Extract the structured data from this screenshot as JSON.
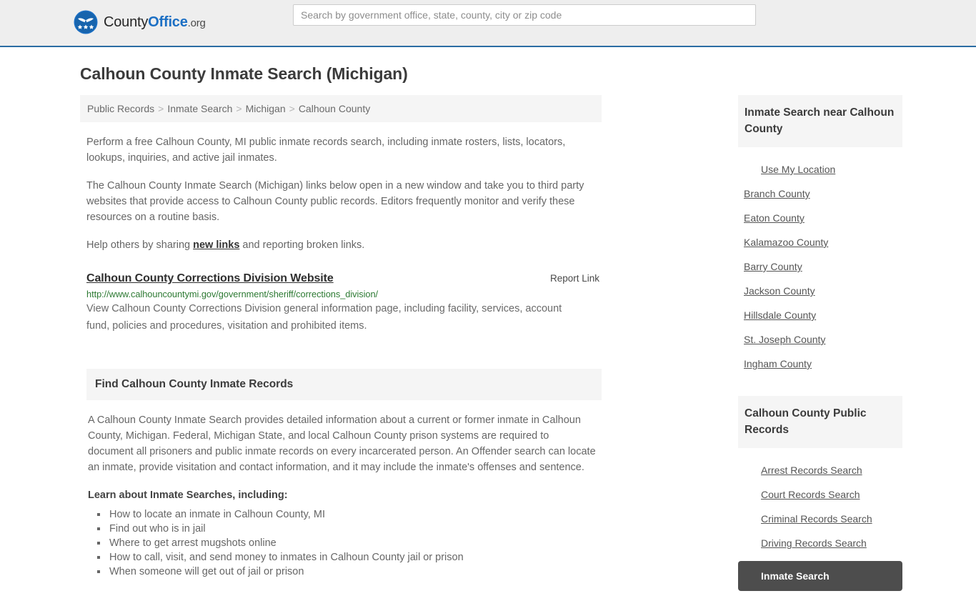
{
  "header": {
    "brand": {
      "part1": "County",
      "part2": "Office",
      "part3": ".org",
      "icon": "eagle-shield-icon"
    },
    "search": {
      "placeholder": "Search by government office, state, county, city or zip code",
      "value": ""
    }
  },
  "main": {
    "page_title": "Calhoun County Inmate Search (Michigan)",
    "breadcrumb": {
      "separator": ">",
      "items": [
        "Public Records",
        "Inmate Search",
        "Michigan",
        "Calhoun County"
      ]
    },
    "intro_paragraph": "Perform a free Calhoun County, MI public inmate records search, including inmate rosters, lists, locators, lookups, inquiries, and active jail inmates.",
    "second_paragraph": "The Calhoun County Inmate Search (Michigan) links below open in a new window and take you to third party websites that provide access to Calhoun County public records. Editors frequently monitor and verify these resources on a routine basis.",
    "help_prefix": "Help others by sharing ",
    "help_link": "new links",
    "help_suffix": " and reporting broken links.",
    "result": {
      "title": "Calhoun County Corrections Division Website",
      "report_label": "Report Link",
      "url": "http://www.calhouncountymi.gov/government/sheriff/corrections_division/",
      "description": "View Calhoun County Corrections Division general information page, including facility, services, account fund, policies and procedures, visitation and prohibited items."
    },
    "section": {
      "heading": "Find Calhoun County Inmate Records",
      "body": "A Calhoun County Inmate Search provides detailed information about a current or former inmate in Calhoun County, Michigan. Federal, Michigan State, and local Calhoun County prison systems are required to document all prisoners and public inmate records on every incarcerated person. An Offender search can locate an inmate, provide visitation and contact information, and it may include the inmate's offenses and sentence.",
      "lead_in": "Learn about Inmate Searches, including:",
      "bullets": [
        "How to locate an inmate in Calhoun County, MI",
        "Find out who is in jail",
        "Where to get arrest mugshots online",
        "How to call, visit, and send money to inmates in Calhoun County jail or prison",
        "When someone will get out of jail or prison"
      ]
    }
  },
  "sidebar": {
    "near_panel": {
      "heading": "Inmate Search near Calhoun County",
      "items": [
        {
          "label": "Use My Location",
          "indented": true,
          "active": false
        },
        {
          "label": "Branch County",
          "indented": false,
          "active": false
        },
        {
          "label": "Eaton County",
          "indented": false,
          "active": false
        },
        {
          "label": "Kalamazoo County",
          "indented": false,
          "active": false
        },
        {
          "label": "Barry County",
          "indented": false,
          "active": false
        },
        {
          "label": "Jackson County",
          "indented": false,
          "active": false
        },
        {
          "label": "Hillsdale County",
          "indented": false,
          "active": false
        },
        {
          "label": "St. Joseph County",
          "indented": false,
          "active": false
        },
        {
          "label": "Ingham County",
          "indented": false,
          "active": false
        }
      ]
    },
    "records_panel": {
      "heading": "Calhoun County Public Records",
      "items": [
        {
          "label": "Arrest Records Search",
          "indented": true,
          "active": false
        },
        {
          "label": "Court Records Search",
          "indented": true,
          "active": false
        },
        {
          "label": "Criminal Records Search",
          "indented": true,
          "active": false
        },
        {
          "label": "Driving Records Search",
          "indented": true,
          "active": false
        },
        {
          "label": "Inmate Search",
          "indented": true,
          "active": true
        }
      ]
    }
  },
  "colors": {
    "header_bg": "#eeeeee",
    "header_border": "#2b6ca3",
    "brand_blue": "#1b6fc4",
    "url_green": "#2d7a33",
    "panel_head_bg": "#f5f5f5",
    "active_bg": "#4d4d4d"
  }
}
